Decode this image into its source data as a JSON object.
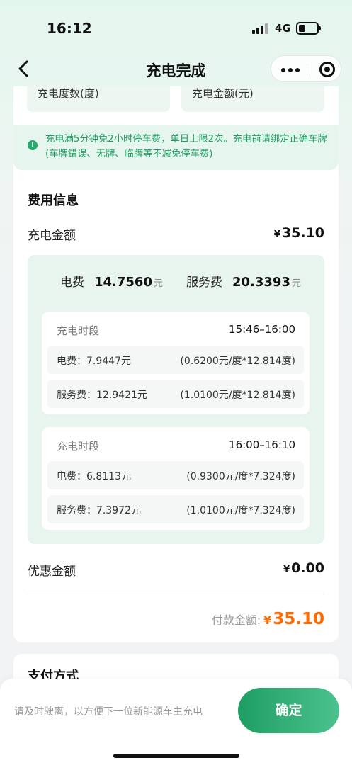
{
  "status": {
    "time": "16:12",
    "network": "4G"
  },
  "nav": {
    "title": "充电完成"
  },
  "summary": {
    "kwh_label": "充电度数(度)",
    "amount_label": "充电金额(元)"
  },
  "notice": {
    "text": "充电满5分钟免2小时停车费，单日上限2次。充电前请绑定正确车牌(车牌错误、无牌、临牌等不减免停车费)"
  },
  "fees": {
    "title": "费用信息",
    "charge_label": "充电金额",
    "currency": "¥",
    "charge_amount": "35.10",
    "electric_label": "电费",
    "electric_value": "14.7560",
    "service_label": "服务费",
    "service_value": "20.3393",
    "unit": "元",
    "periods": [
      {
        "label": "充电时段",
        "time": "15:46–16:00",
        "electric": "电费：7.9447元",
        "electric_calc": "(0.6200元/度*12.814度)",
        "service": "服务费：12.9421元",
        "service_calc": "(1.0100元/度*12.814度)"
      },
      {
        "label": "充电时段",
        "time": "16:00–16:10",
        "electric": "电费：6.8113元",
        "electric_calc": "(0.9300元/度*7.324度)",
        "service": "服务费：7.3972元",
        "service_calc": "(1.0100元/度*7.324度)"
      }
    ],
    "discount_label": "优惠金额",
    "discount_amount": "0.00",
    "pay_label": "付款金额:",
    "pay_amount": "35.10"
  },
  "payment": {
    "title": "支付方式"
  },
  "bottom": {
    "tip": "请及时驶离，以方便下一位新能源车主充电",
    "confirm_label": "确定"
  },
  "colors": {
    "brand_green": "#1e9e62",
    "pay_orange": "#ff6a00",
    "notice_green": "#1f9f62"
  }
}
